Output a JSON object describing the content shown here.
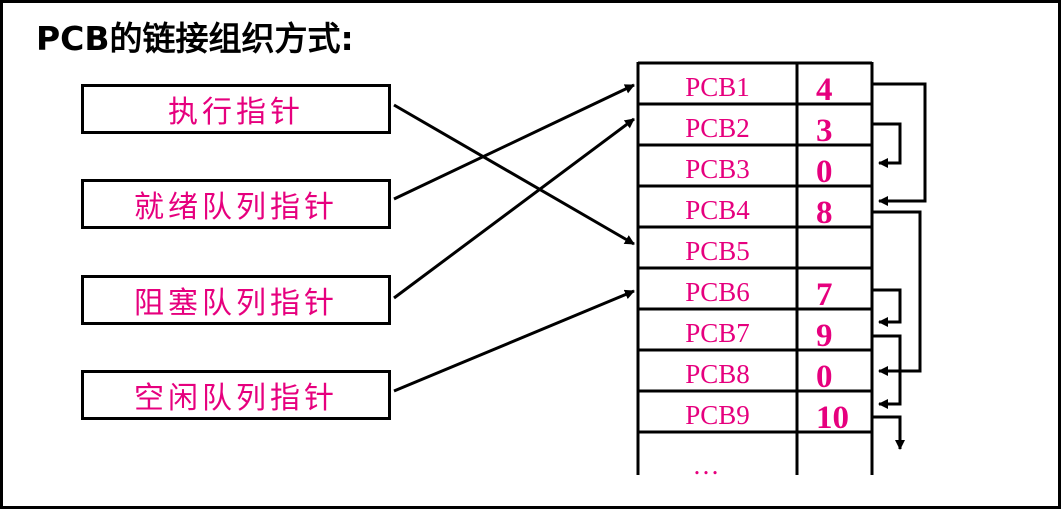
{
  "title": "PCB的链接组织方式:",
  "pointers": [
    {
      "label": "执行指针"
    },
    {
      "label": "就绪队列指针"
    },
    {
      "label": "阻塞队列指针"
    },
    {
      "label": "空闲队列指针"
    }
  ],
  "pcb_table": {
    "rows": [
      {
        "name": "PCB1",
        "next": "4"
      },
      {
        "name": "PCB2",
        "next": "3"
      },
      {
        "name": "PCB3",
        "next": "0"
      },
      {
        "name": "PCB4",
        "next": "8"
      },
      {
        "name": "PCB5",
        "next": ""
      },
      {
        "name": "PCB6",
        "next": "7"
      },
      {
        "name": "PCB7",
        "next": "9"
      },
      {
        "name": "PCB8",
        "next": "0"
      },
      {
        "name": "PCB9",
        "next": "10"
      }
    ],
    "ellipsis": "…"
  },
  "colors": {
    "text_accent": "#e6007e",
    "line": "#000000"
  }
}
